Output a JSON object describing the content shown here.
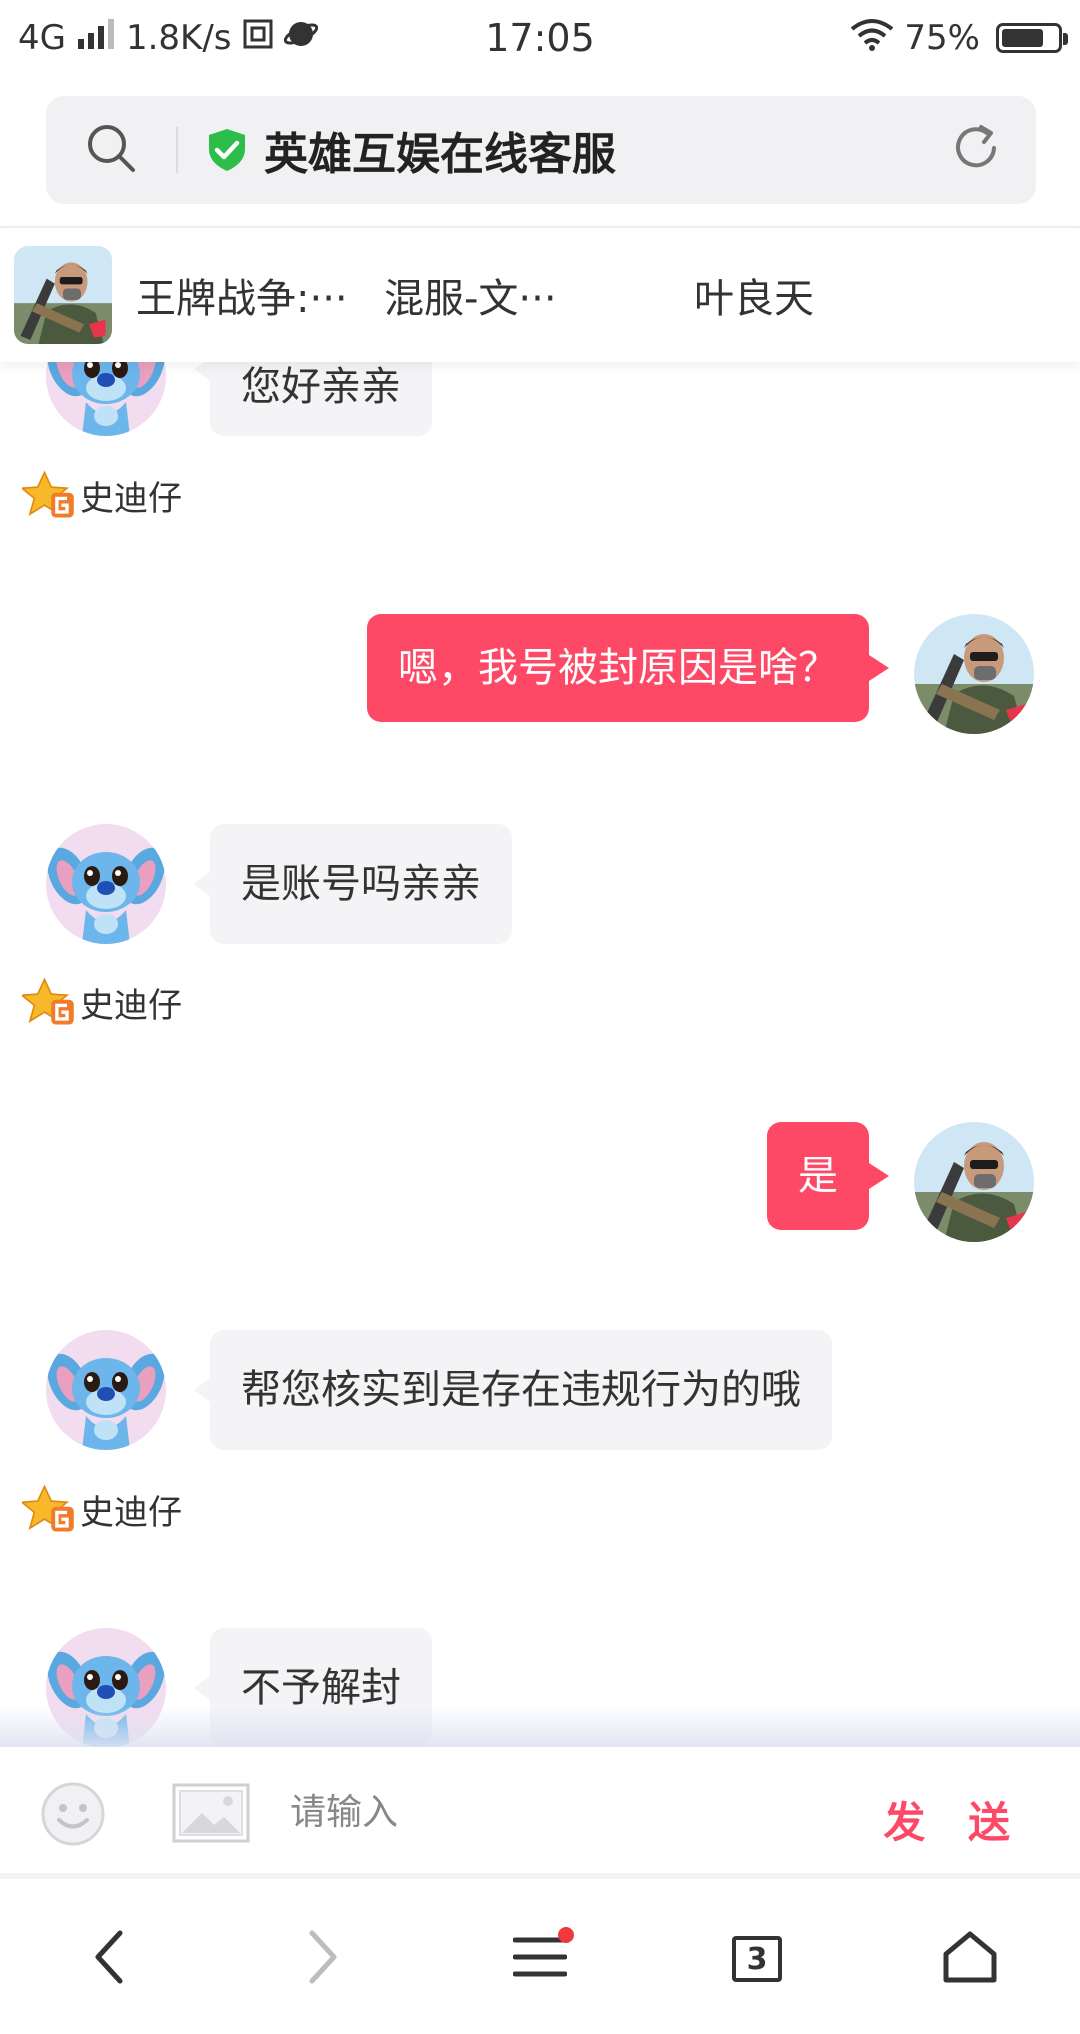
{
  "status_bar": {
    "network": "4G",
    "speed": "1.8K/s",
    "time": "17:05",
    "battery_percent": "75%",
    "battery_level": 0.75
  },
  "url_bar": {
    "title": "英雄互娱在线客服"
  },
  "chat_header": {
    "game_name": "王牌战争:···",
    "server": "混服-文···",
    "player": "叶良天"
  },
  "messages": [
    {
      "side": "in",
      "text": "您好亲亲",
      "sender": "史迪仔"
    },
    {
      "side": "out",
      "text": "嗯，我号被封原因是啥？"
    },
    {
      "side": "in",
      "text": "是账号吗亲亲",
      "sender": "史迪仔"
    },
    {
      "side": "out",
      "text": "是"
    },
    {
      "side": "in",
      "text": "帮您核实到是存在违规行为的哦",
      "sender": "史迪仔"
    },
    {
      "side": "in",
      "text": "不予解封"
    }
  ],
  "input_bar": {
    "placeholder": "请输入",
    "send_label": "发 送"
  },
  "browser_nav": {
    "tab_count": "3"
  },
  "colors": {
    "accent": "#fe4966",
    "incoming_bubble": "#f4f4f6",
    "url_bar_bg": "#f1f1f3",
    "shield_green": "#2dbd4a"
  },
  "icons": {
    "emoji": "smiley-face-icon",
    "image": "image-icon",
    "shield": "shield-check-icon",
    "search": "search-icon",
    "refresh": "refresh-icon"
  }
}
